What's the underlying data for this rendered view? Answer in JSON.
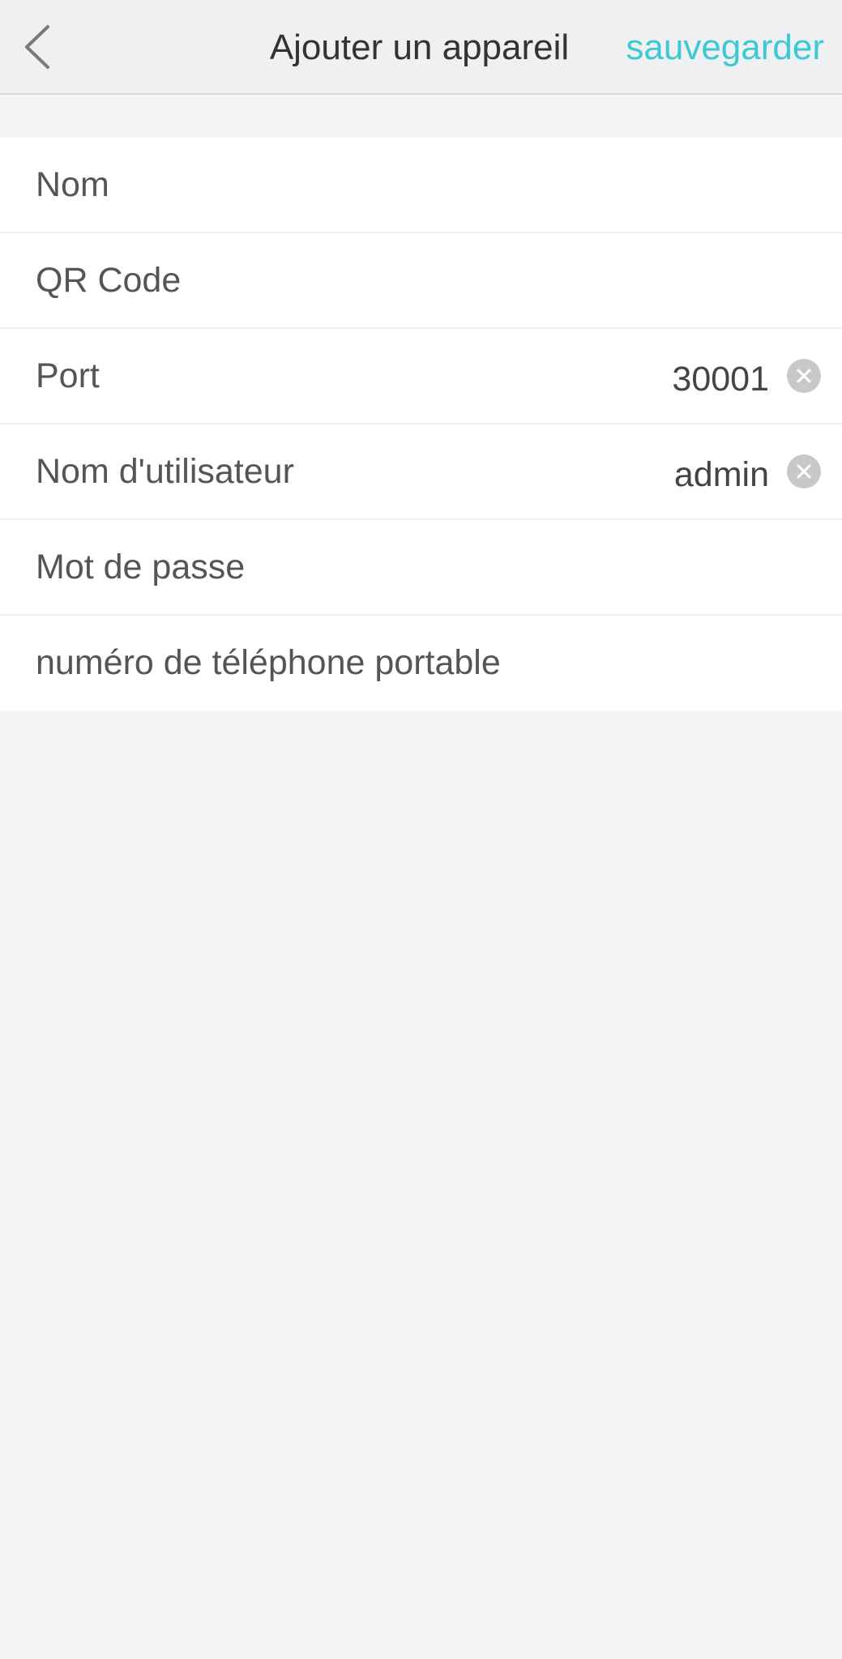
{
  "header": {
    "title": "Ajouter un appareil",
    "save_label": "sauvegarder",
    "back_icon": "chevron-left-icon"
  },
  "colors": {
    "accent": "#3cc9d3",
    "navbar_bg": "#eef0f1",
    "page_bg": "#f5f5f5"
  },
  "form": {
    "fields": [
      {
        "label": "Nom",
        "value": ""
      },
      {
        "label": "QR Code",
        "value": ""
      },
      {
        "label": "Port",
        "value": "30001",
        "clear_icon": "clear-icon"
      },
      {
        "label": "Nom d'utilisateur",
        "value": "admin",
        "clear_icon": "clear-icon"
      },
      {
        "label": "Mot de passe",
        "value": ""
      },
      {
        "label": "numéro de téléphone portable",
        "value": ""
      }
    ]
  }
}
